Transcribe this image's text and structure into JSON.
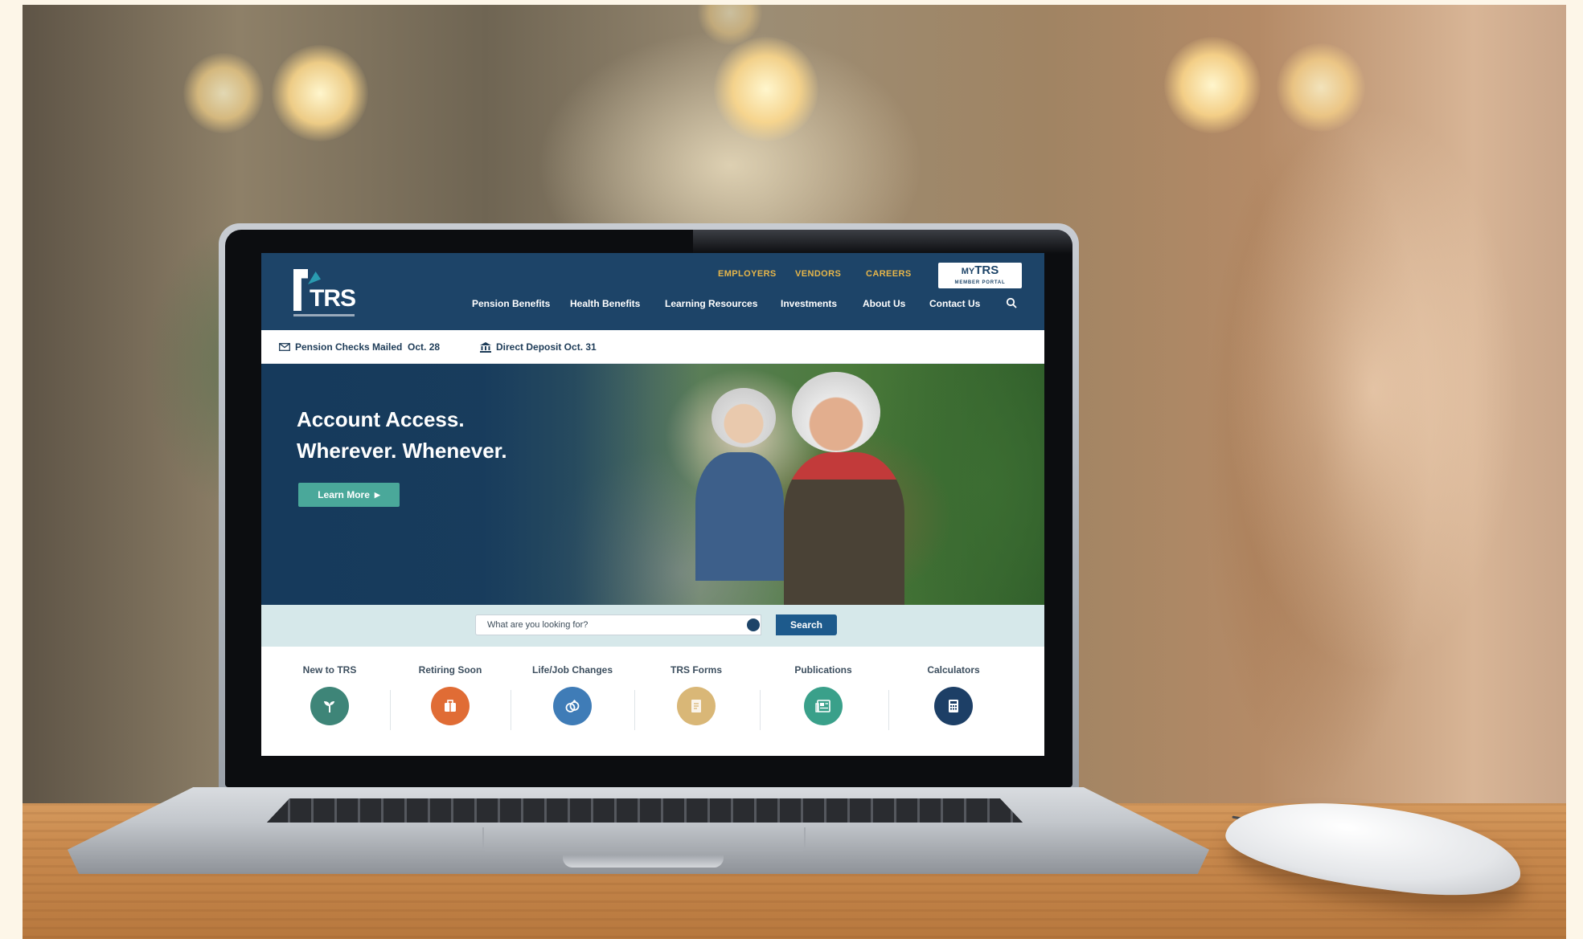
{
  "site": {
    "logo_text": "TRS",
    "utility_nav": [
      "EMPLOYERS",
      "VENDORS",
      "CAREERS"
    ],
    "portal": {
      "my": "MY",
      "name": "TRS",
      "subtitle": "MEMBER PORTAL"
    },
    "main_nav": [
      "Pension Benefits",
      "Health Benefits",
      "Learning Resources",
      "Investments",
      "About Us",
      "Contact Us"
    ],
    "search_icon": "search-icon"
  },
  "alerts": [
    {
      "icon": "mail-icon",
      "text": "Pension Checks Mailed  Oct. 28"
    },
    {
      "icon": "bank-icon",
      "text": "Direct Deposit Oct. 31"
    }
  ],
  "hero": {
    "line1": "Account Access.",
    "line2": "Wherever. Whenever.",
    "button": "Learn More",
    "button_icon": "play-icon"
  },
  "search": {
    "placeholder": "What are you looking for?",
    "button": "Search"
  },
  "quick_links": [
    {
      "label": "New to TRS",
      "icon": "sprout-icon",
      "color": "#3e8578"
    },
    {
      "label": "Retiring Soon",
      "icon": "suitcase-icon",
      "color": "#e06c35"
    },
    {
      "label": "Life/Job Changes",
      "icon": "rings-icon",
      "color": "#3f7cb7"
    },
    {
      "label": "TRS Forms",
      "icon": "document-icon",
      "color": "#d9b777"
    },
    {
      "label": "Publications",
      "icon": "newspaper-icon",
      "color": "#3aa08a"
    },
    {
      "label": "Calculators",
      "icon": "calculator-icon",
      "color": "#1d3f66"
    }
  ],
  "colors": {
    "header": "#1d4468",
    "accent": "#e7b64a",
    "button": "#4aa89a"
  }
}
